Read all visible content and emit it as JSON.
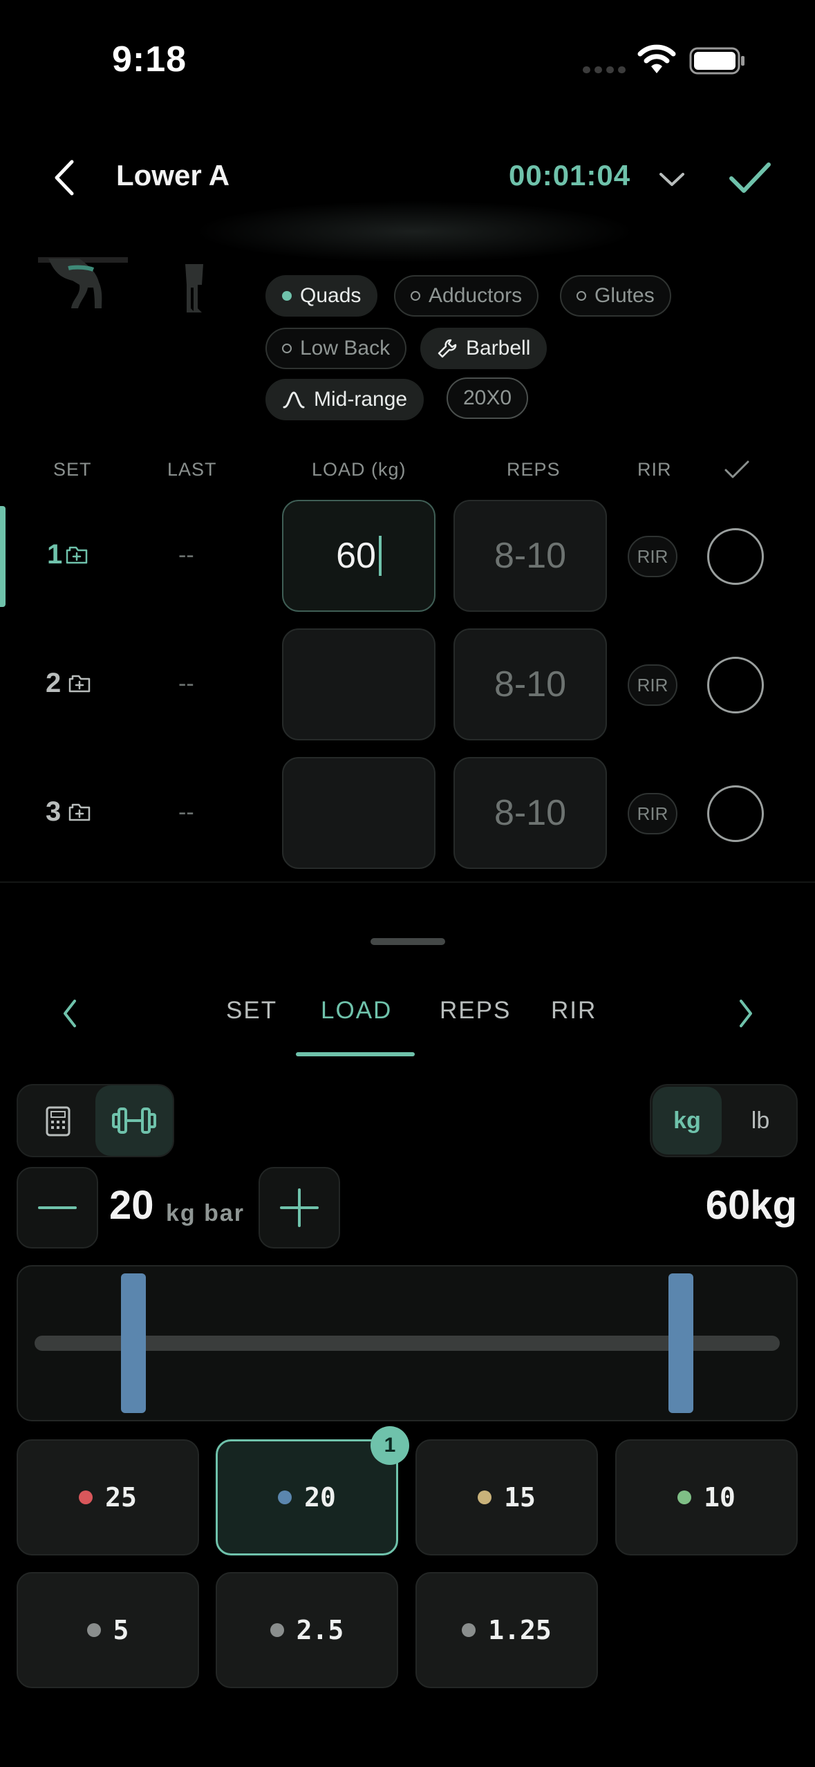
{
  "status_bar": {
    "time": "9:18"
  },
  "header": {
    "title": "Lower A",
    "timer": "00:01:04",
    "back_icon": "chevron-left-icon",
    "expand_icon": "chevron-down-icon",
    "finish_icon": "checkmark-icon"
  },
  "exercise": {
    "chips": [
      {
        "label": "Quads",
        "style": "active-dot"
      },
      {
        "label": "Adductors",
        "style": "ring-dot"
      },
      {
        "label": "Glutes",
        "style": "ring-dot"
      },
      {
        "label": "Low Back",
        "style": "ring-dot"
      },
      {
        "label": "Barbell",
        "style": "active-wrench"
      },
      {
        "label": "Mid-range",
        "style": "active-arc"
      },
      {
        "label": "20X0",
        "style": "tempo"
      }
    ]
  },
  "table": {
    "headers": {
      "set": "SET",
      "last": "LAST",
      "load": "LOAD (kg)",
      "reps": "REPS",
      "rir": "RIR"
    },
    "rows": [
      {
        "set": "1",
        "last": "--",
        "load": "60",
        "reps": "8-10",
        "rir": "RIR",
        "active": true
      },
      {
        "set": "2",
        "last": "--",
        "load": "",
        "reps": "8-10",
        "rir": "RIR",
        "active": false
      },
      {
        "set": "3",
        "last": "--",
        "load": "",
        "reps": "8-10",
        "rir": "RIR",
        "active": false
      }
    ]
  },
  "keypad": {
    "tabs": [
      "SET",
      "LOAD",
      "REPS",
      "RIR"
    ],
    "active_tab": "LOAD",
    "units": {
      "kg": "kg",
      "lb": "lb",
      "selected": "kg"
    },
    "bar": {
      "weight": "20",
      "unit_label": "kg bar"
    },
    "total": "60kg",
    "plates": [
      {
        "value": "25",
        "color": "#d9575b"
      },
      {
        "value": "20",
        "color": "#5b86ae",
        "selected": true,
        "count": "1"
      },
      {
        "value": "15",
        "color": "#c9b27a"
      },
      {
        "value": "10",
        "color": "#7fbf86"
      },
      {
        "value": "5",
        "color": "#8a8e8d"
      },
      {
        "value": "2.5",
        "color": "#8a8e8d"
      },
      {
        "value": "1.25",
        "color": "#8a8e8d"
      }
    ]
  },
  "colors": {
    "accent": "#6fc2ab",
    "background": "#000000",
    "plate_20": "#5b86ae"
  }
}
